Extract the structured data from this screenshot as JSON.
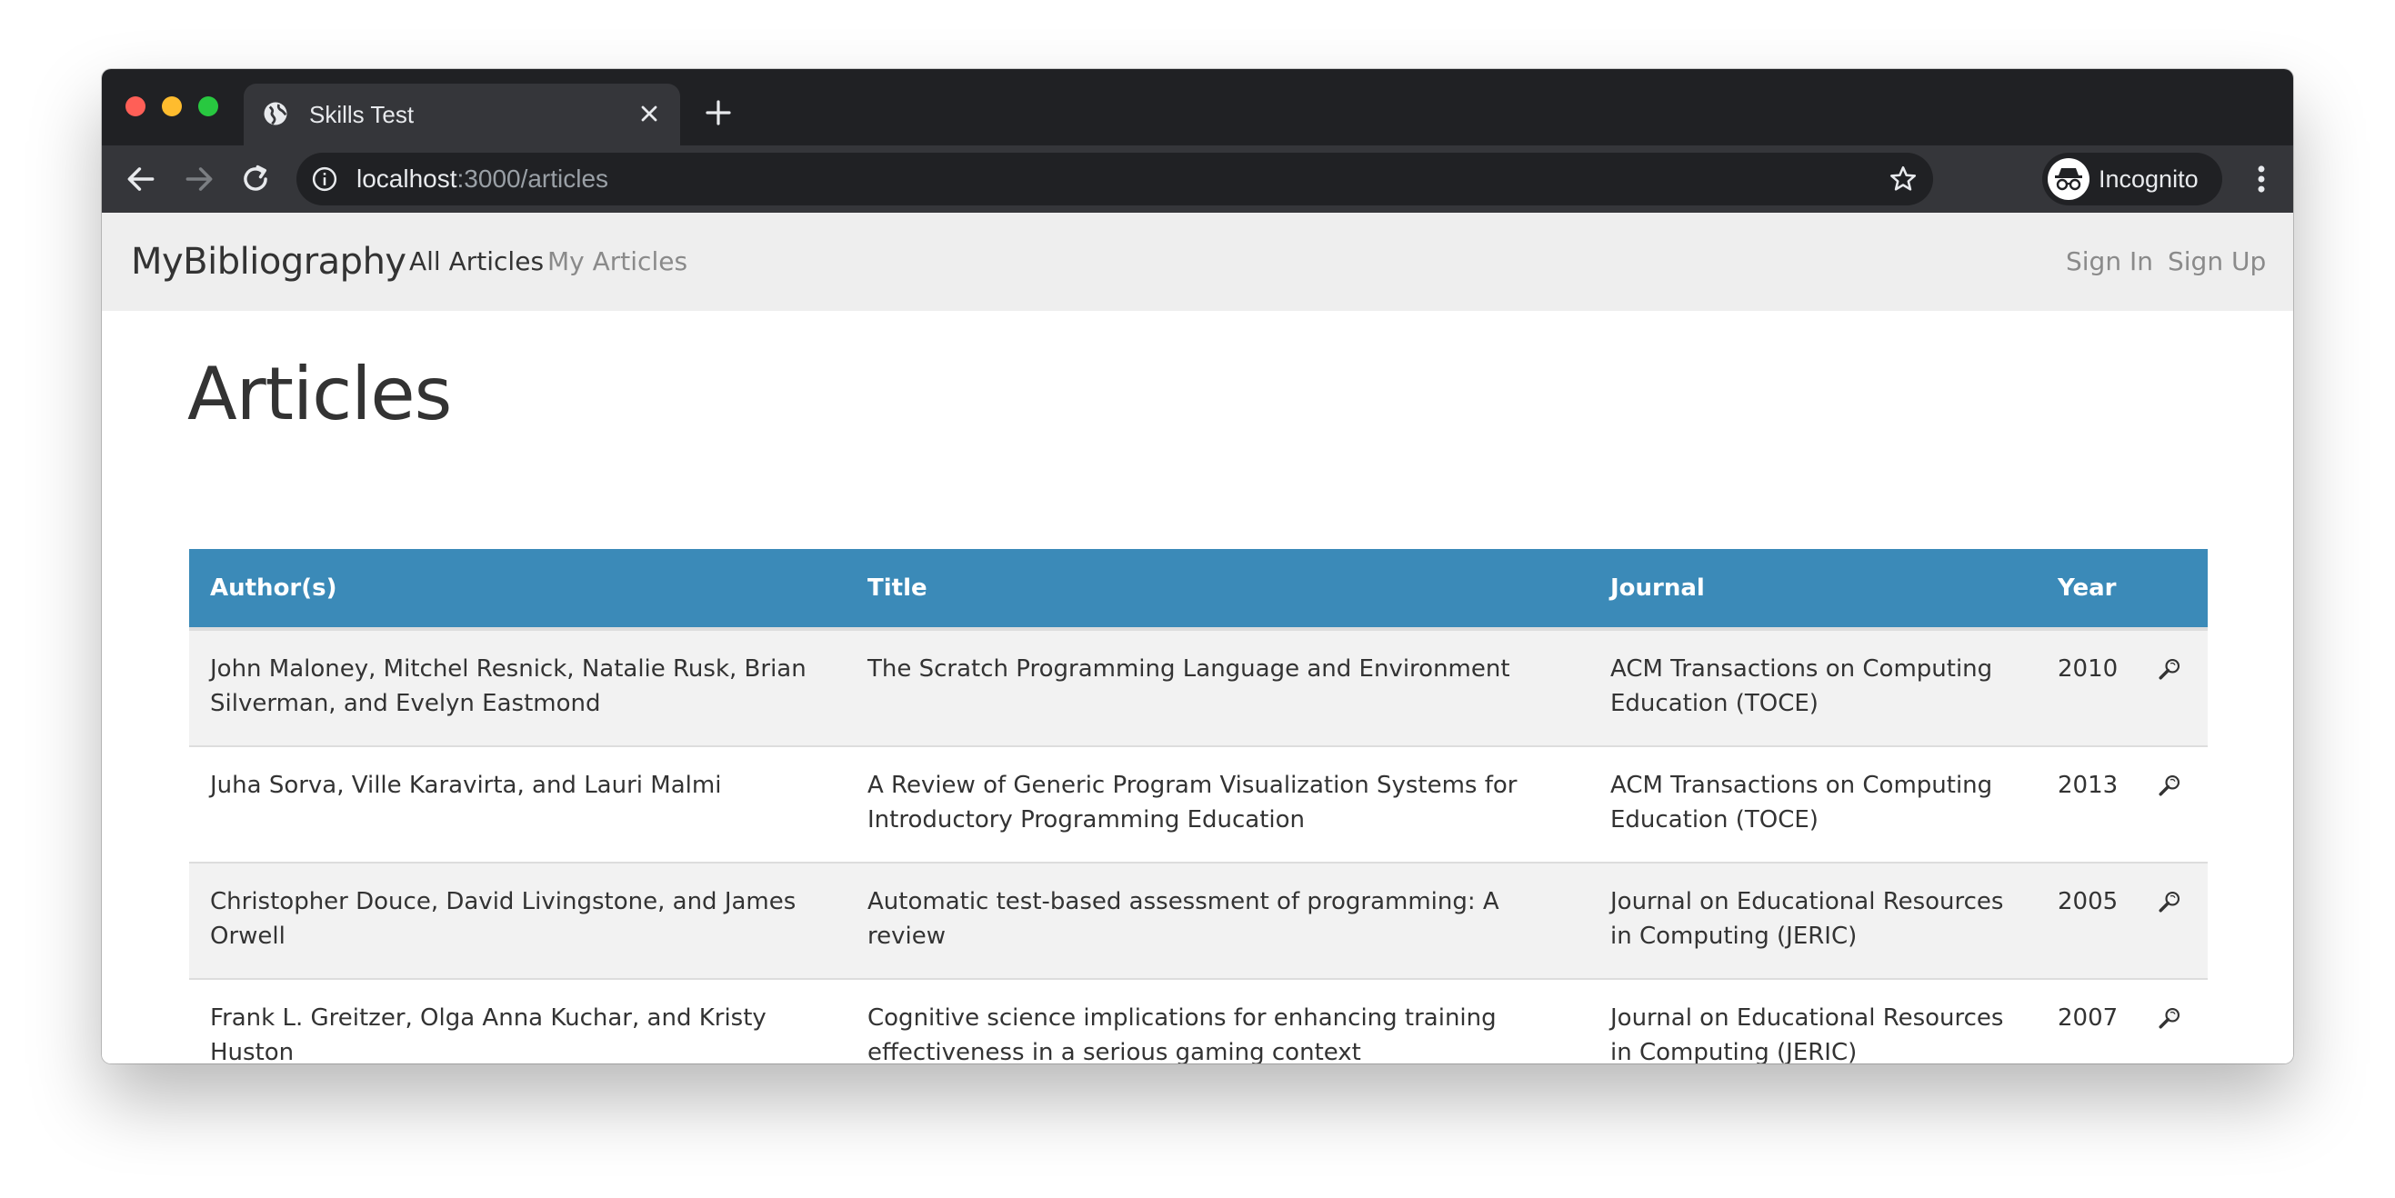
{
  "browser": {
    "tab_title": "Skills Test",
    "url_host": "localhost",
    "url_path": ":3000/articles",
    "incognito_label": "Incognito"
  },
  "navbar": {
    "brand": "MyBibliography",
    "links": [
      "All Articles",
      "My Articles"
    ],
    "right_links": [
      "Sign In",
      "Sign Up"
    ]
  },
  "page": {
    "title": "Articles"
  },
  "table": {
    "headers": [
      "Author(s)",
      "Title",
      "Journal",
      "Year"
    ],
    "header_color": "#3b8ab8",
    "rows": [
      {
        "authors": "John Maloney, Mitchel Resnick, Natalie Rusk, Brian Silverman, and Evelyn Eastmond",
        "title": "The Scratch Programming Language and Environment",
        "journal": "ACM Transactions on Computing Education (TOCE)",
        "year": "2010",
        "action_icon": "magnifier-icon"
      },
      {
        "authors": "Juha Sorva, Ville Karavirta, and Lauri Malmi",
        "title": "A Review of Generic Program Visualization Systems for Introductory Programming Education",
        "journal": "ACM Transactions on Computing Education (TOCE)",
        "year": "2013",
        "action_icon": "magnifier-icon"
      },
      {
        "authors": "Christopher Douce, David Livingstone, and James Orwell",
        "title": "Automatic test-based assessment of programming: A review",
        "journal": "Journal on Educational Resources in Computing (JERIC)",
        "year": "2005",
        "action_icon": "magnifier-icon"
      },
      {
        "authors": "Frank L. Greitzer, Olga Anna Kuchar, and Kristy Huston",
        "title": "Cognitive science implications for enhancing training effectiveness in a serious gaming context",
        "journal": "Journal on Educational Resources in Computing (JERIC)",
        "year": "2007",
        "action_icon": "magnifier-icon"
      }
    ]
  }
}
